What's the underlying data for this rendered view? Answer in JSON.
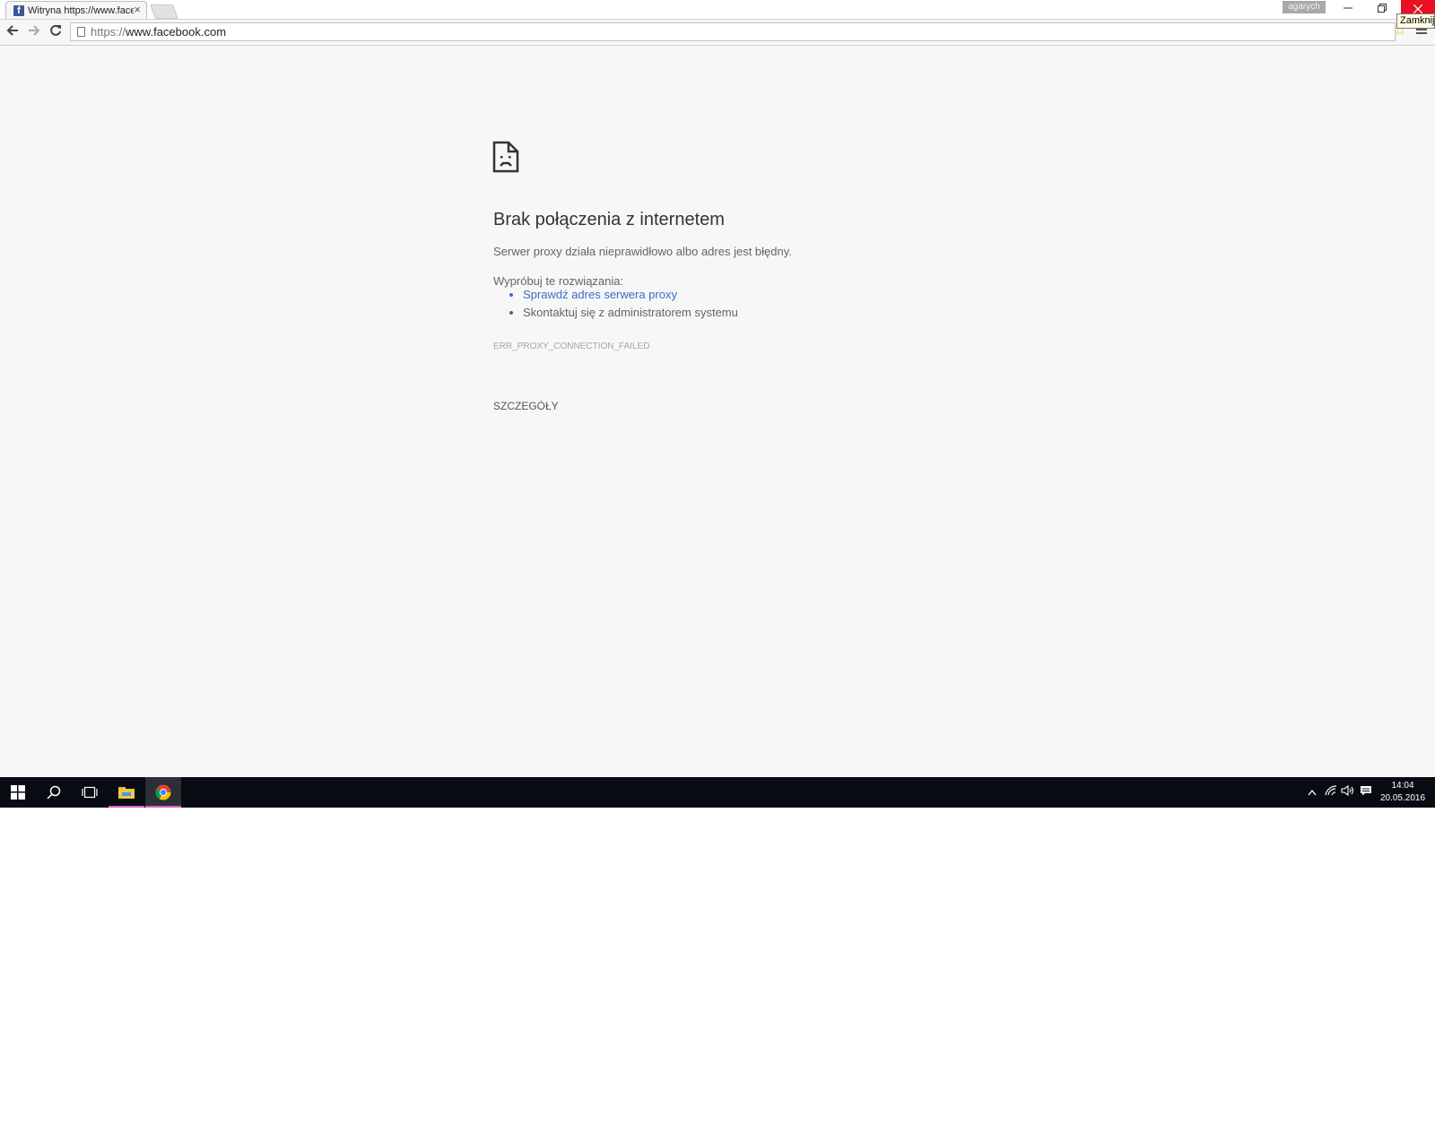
{
  "browser": {
    "tab": {
      "title": "Witryna https://www.facebook.com",
      "favicon": "f",
      "close_glyph": "×"
    },
    "profile_label": "agarych",
    "window": {
      "close_tooltip": "Zamknij"
    },
    "address": {
      "scheme": "https://",
      "host": "www.facebook.com"
    }
  },
  "error_page": {
    "title": "Brak połączenia z internetem",
    "summary": "Serwer proxy działa nieprawidłowo albo adres jest błędny.",
    "suggestions_heading": "Wypróbuj te rozwiązania:",
    "suggestions": [
      "Sprawdź adres serwera proxy",
      "Skontaktuj się z administratorem systemu"
    ],
    "error_code": "ERR_PROXY_CONNECTION_FAILED",
    "details_button": "SZCZEGÓŁY"
  },
  "taskbar": {
    "time": "14:04",
    "date": "20.05.2016"
  },
  "colors": {
    "close_button": "#e81123",
    "link": "#3b6cc7",
    "taskbar": "#080c12",
    "active_indicator": "#d95fd0"
  }
}
